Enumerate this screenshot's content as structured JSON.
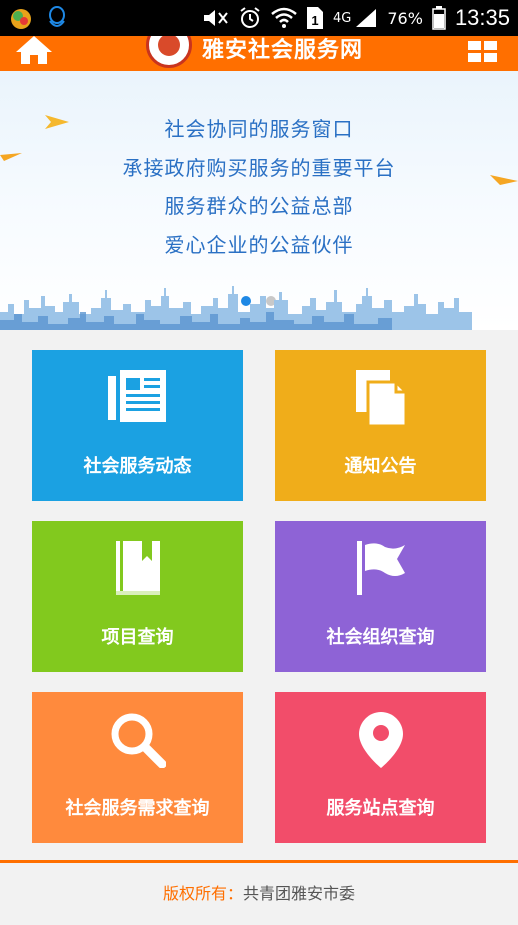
{
  "status_bar": {
    "battery_percent": "76%",
    "network": "4G",
    "time": "13:35"
  },
  "header": {
    "title": "雅安社会服务网"
  },
  "banner": {
    "lines": [
      "社会协同的服务窗口",
      "承接政府购买服务的重要平台",
      "服务群众的公益总部",
      "爱心企业的公益伙伴"
    ]
  },
  "tiles": [
    {
      "label": "社会服务动态",
      "color": "#1ba1e2",
      "icon": "news-icon"
    },
    {
      "label": "通知公告",
      "color": "#f0ad1a",
      "icon": "documents-icon"
    },
    {
      "label": "项目查询",
      "color": "#82c91e",
      "icon": "book-icon"
    },
    {
      "label": "社会组织查询",
      "color": "#8e63d6",
      "icon": "flag-icon"
    },
    {
      "label": "社会服务需求查询",
      "color": "#ff8a3d",
      "icon": "search-icon"
    },
    {
      "label": "服务站点查询",
      "color": "#f24d6a",
      "icon": "location-pin-icon"
    }
  ],
  "footer": {
    "label": "版权所有：",
    "owner": "共青团雅安市委"
  },
  "colors": {
    "brand": "#ff6f00",
    "slogan": "#2a70c4"
  }
}
